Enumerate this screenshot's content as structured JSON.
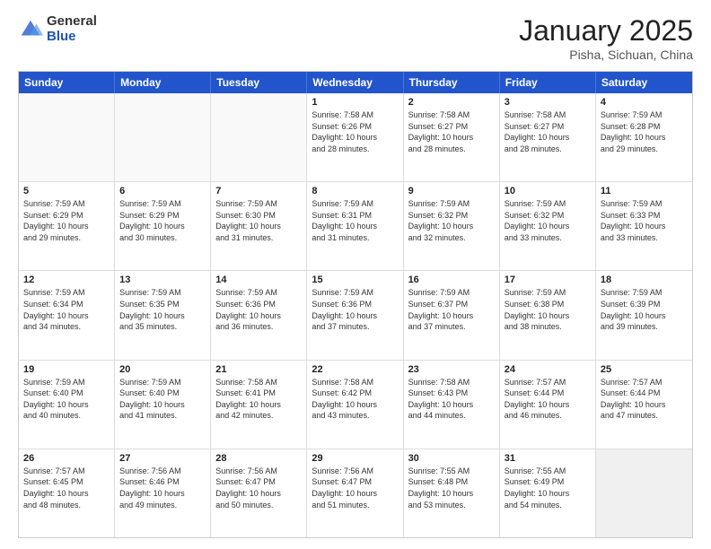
{
  "logo": {
    "general": "General",
    "blue": "Blue"
  },
  "title": {
    "month": "January 2025",
    "location": "Pisha, Sichuan, China"
  },
  "header_days": [
    "Sunday",
    "Monday",
    "Tuesday",
    "Wednesday",
    "Thursday",
    "Friday",
    "Saturday"
  ],
  "rows": [
    [
      {
        "day": "",
        "info": ""
      },
      {
        "day": "",
        "info": ""
      },
      {
        "day": "",
        "info": ""
      },
      {
        "day": "1",
        "info": "Sunrise: 7:58 AM\nSunset: 6:26 PM\nDaylight: 10 hours\nand 28 minutes."
      },
      {
        "day": "2",
        "info": "Sunrise: 7:58 AM\nSunset: 6:27 PM\nDaylight: 10 hours\nand 28 minutes."
      },
      {
        "day": "3",
        "info": "Sunrise: 7:58 AM\nSunset: 6:27 PM\nDaylight: 10 hours\nand 28 minutes."
      },
      {
        "day": "4",
        "info": "Sunrise: 7:59 AM\nSunset: 6:28 PM\nDaylight: 10 hours\nand 29 minutes."
      }
    ],
    [
      {
        "day": "5",
        "info": "Sunrise: 7:59 AM\nSunset: 6:29 PM\nDaylight: 10 hours\nand 29 minutes."
      },
      {
        "day": "6",
        "info": "Sunrise: 7:59 AM\nSunset: 6:29 PM\nDaylight: 10 hours\nand 30 minutes."
      },
      {
        "day": "7",
        "info": "Sunrise: 7:59 AM\nSunset: 6:30 PM\nDaylight: 10 hours\nand 31 minutes."
      },
      {
        "day": "8",
        "info": "Sunrise: 7:59 AM\nSunset: 6:31 PM\nDaylight: 10 hours\nand 31 minutes."
      },
      {
        "day": "9",
        "info": "Sunrise: 7:59 AM\nSunset: 6:32 PM\nDaylight: 10 hours\nand 32 minutes."
      },
      {
        "day": "10",
        "info": "Sunrise: 7:59 AM\nSunset: 6:32 PM\nDaylight: 10 hours\nand 33 minutes."
      },
      {
        "day": "11",
        "info": "Sunrise: 7:59 AM\nSunset: 6:33 PM\nDaylight: 10 hours\nand 33 minutes."
      }
    ],
    [
      {
        "day": "12",
        "info": "Sunrise: 7:59 AM\nSunset: 6:34 PM\nDaylight: 10 hours\nand 34 minutes."
      },
      {
        "day": "13",
        "info": "Sunrise: 7:59 AM\nSunset: 6:35 PM\nDaylight: 10 hours\nand 35 minutes."
      },
      {
        "day": "14",
        "info": "Sunrise: 7:59 AM\nSunset: 6:36 PM\nDaylight: 10 hours\nand 36 minutes."
      },
      {
        "day": "15",
        "info": "Sunrise: 7:59 AM\nSunset: 6:36 PM\nDaylight: 10 hours\nand 37 minutes."
      },
      {
        "day": "16",
        "info": "Sunrise: 7:59 AM\nSunset: 6:37 PM\nDaylight: 10 hours\nand 37 minutes."
      },
      {
        "day": "17",
        "info": "Sunrise: 7:59 AM\nSunset: 6:38 PM\nDaylight: 10 hours\nand 38 minutes."
      },
      {
        "day": "18",
        "info": "Sunrise: 7:59 AM\nSunset: 6:39 PM\nDaylight: 10 hours\nand 39 minutes."
      }
    ],
    [
      {
        "day": "19",
        "info": "Sunrise: 7:59 AM\nSunset: 6:40 PM\nDaylight: 10 hours\nand 40 minutes."
      },
      {
        "day": "20",
        "info": "Sunrise: 7:59 AM\nSunset: 6:40 PM\nDaylight: 10 hours\nand 41 minutes."
      },
      {
        "day": "21",
        "info": "Sunrise: 7:58 AM\nSunset: 6:41 PM\nDaylight: 10 hours\nand 42 minutes."
      },
      {
        "day": "22",
        "info": "Sunrise: 7:58 AM\nSunset: 6:42 PM\nDaylight: 10 hours\nand 43 minutes."
      },
      {
        "day": "23",
        "info": "Sunrise: 7:58 AM\nSunset: 6:43 PM\nDaylight: 10 hours\nand 44 minutes."
      },
      {
        "day": "24",
        "info": "Sunrise: 7:57 AM\nSunset: 6:44 PM\nDaylight: 10 hours\nand 46 minutes."
      },
      {
        "day": "25",
        "info": "Sunrise: 7:57 AM\nSunset: 6:44 PM\nDaylight: 10 hours\nand 47 minutes."
      }
    ],
    [
      {
        "day": "26",
        "info": "Sunrise: 7:57 AM\nSunset: 6:45 PM\nDaylight: 10 hours\nand 48 minutes."
      },
      {
        "day": "27",
        "info": "Sunrise: 7:56 AM\nSunset: 6:46 PM\nDaylight: 10 hours\nand 49 minutes."
      },
      {
        "day": "28",
        "info": "Sunrise: 7:56 AM\nSunset: 6:47 PM\nDaylight: 10 hours\nand 50 minutes."
      },
      {
        "day": "29",
        "info": "Sunrise: 7:56 AM\nSunset: 6:47 PM\nDaylight: 10 hours\nand 51 minutes."
      },
      {
        "day": "30",
        "info": "Sunrise: 7:55 AM\nSunset: 6:48 PM\nDaylight: 10 hours\nand 53 minutes."
      },
      {
        "day": "31",
        "info": "Sunrise: 7:55 AM\nSunset: 6:49 PM\nDaylight: 10 hours\nand 54 minutes."
      },
      {
        "day": "",
        "info": ""
      }
    ]
  ]
}
